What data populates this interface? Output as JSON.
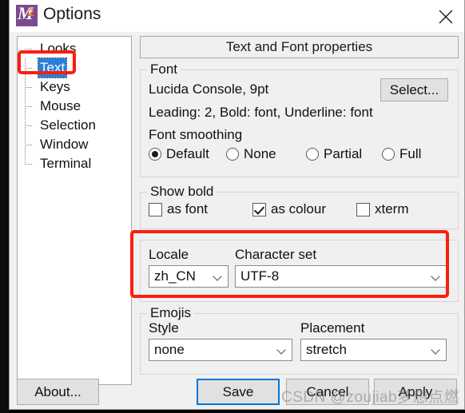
{
  "window": {
    "title": "Options",
    "icon_name": "mintty-logo-icon",
    "close_label": "✕",
    "icon_letter": "M",
    "icon_digit": "2"
  },
  "tree": {
    "items": [
      {
        "label": "Looks",
        "selected": false
      },
      {
        "label": "Text",
        "selected": true
      },
      {
        "label": "Keys",
        "selected": false
      },
      {
        "label": "Mouse",
        "selected": false
      },
      {
        "label": "Selection",
        "selected": false
      },
      {
        "label": "Window",
        "selected": false
      },
      {
        "label": "Terminal",
        "selected": false
      }
    ]
  },
  "panel": {
    "title": "Text and Font properties",
    "font_group": {
      "title": "Font",
      "font_name": "Lucida Console, 9pt",
      "font_detail": "Leading: 2, Bold: font, Underline: font",
      "select_button": "Select...",
      "smoothing_label": "Font smoothing",
      "smoothing_options": [
        {
          "label": "Default",
          "selected": true
        },
        {
          "label": "None",
          "selected": false
        },
        {
          "label": "Partial",
          "selected": false
        },
        {
          "label": "Full",
          "selected": false
        }
      ]
    },
    "bold_group": {
      "title": "Show bold",
      "options": [
        {
          "label": "as font",
          "checked": false
        },
        {
          "label": "as colour",
          "checked": true
        },
        {
          "label": "xterm",
          "checked": false
        }
      ]
    },
    "locale_group": {
      "locale_label": "Locale",
      "locale_value": "zh_CN",
      "charset_label": "Character set",
      "charset_value": "UTF-8"
    },
    "emoji_group": {
      "title": "Emojis",
      "style_label": "Style",
      "style_value": "none",
      "placement_label": "Placement",
      "placement_value": "stretch"
    }
  },
  "buttons": {
    "about": "About...",
    "save": "Save",
    "cancel": "Cancel",
    "apply": "Apply"
  },
  "watermark": "CSDN @zoujiab梦想点燃",
  "colors": {
    "annotation": "#fa1e0e",
    "selection": "#2a7fdb",
    "focus": "#0078d7",
    "icon_purple": "#7b4a8e",
    "icon_orange": "#e8762c"
  }
}
